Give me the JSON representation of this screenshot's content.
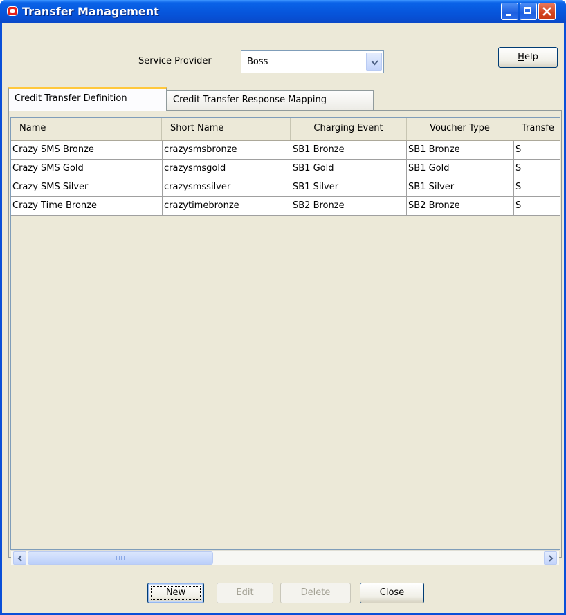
{
  "window": {
    "title": "Transfer Management",
    "icon": "oracle-logo-icon"
  },
  "service_provider": {
    "label": "Service Provider",
    "selected": "Boss"
  },
  "help_button": {
    "label_pre": "",
    "label_accel": "H",
    "label_post": "elp"
  },
  "tabs": [
    {
      "label": "Credit Transfer Definition",
      "active": true
    },
    {
      "label": "Credit Transfer Response Mapping",
      "active": false
    }
  ],
  "table": {
    "columns": [
      "Name",
      "Short Name",
      "Charging Event",
      "Voucher Type",
      "Transfe"
    ],
    "rows": [
      [
        "Crazy SMS Bronze",
        "crazysmsbronze",
        "SB1 Bronze",
        "SB1 Bronze",
        "S"
      ],
      [
        "Crazy SMS Gold",
        "crazysmsgold",
        "SB1 Gold",
        "SB1 Gold",
        "S"
      ],
      [
        "Crazy SMS Silver",
        "crazysmssilver",
        "SB1 Silver",
        "SB1 Silver",
        "S"
      ],
      [
        "Crazy Time Bronze",
        "crazytimebronze",
        "SB2 Bronze",
        "SB2 Bronze",
        "S"
      ]
    ]
  },
  "buttons": {
    "new": {
      "accel": "N",
      "rest": "ew",
      "enabled": true
    },
    "edit": {
      "accel": "E",
      "rest": "dit",
      "enabled": false
    },
    "delete": {
      "accel": "D",
      "rest": "elete",
      "enabled": false
    },
    "close": {
      "accel": "C",
      "rest": "lose",
      "enabled": true
    }
  },
  "colors": {
    "titlebar": "#0a5be0",
    "window_bg": "#ece9d8",
    "active_tab_accent": "#ffc83c"
  }
}
